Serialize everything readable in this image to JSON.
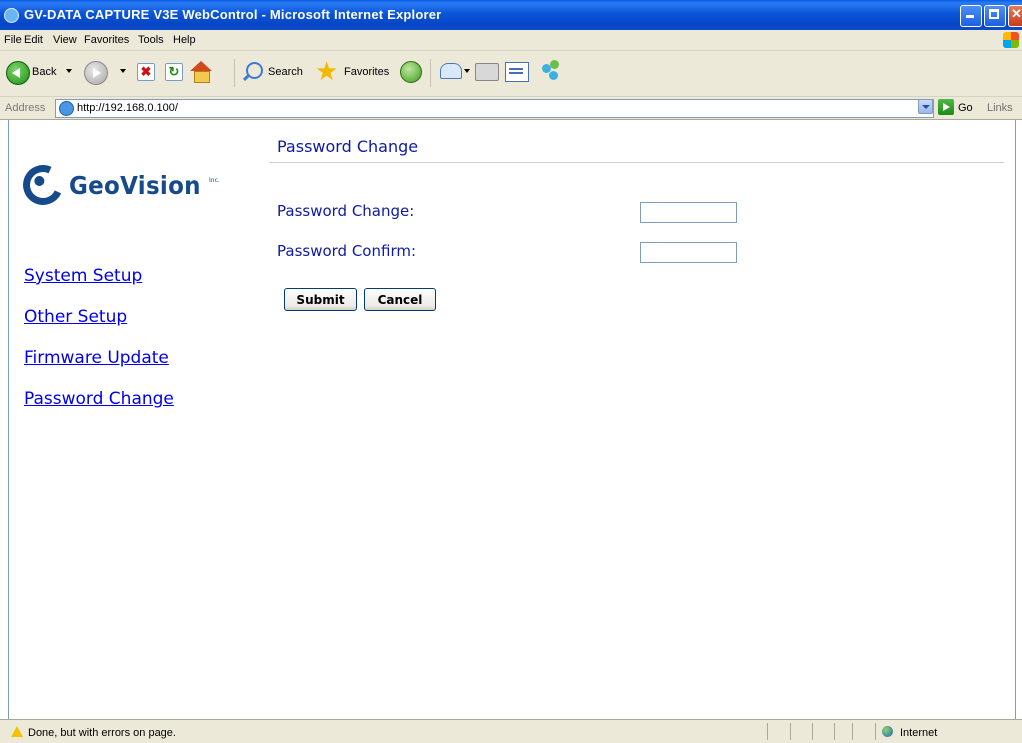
{
  "window": {
    "title": "GV-DATA CAPTURE V3E WebControl - Microsoft Internet Explorer"
  },
  "menu": [
    "File",
    "Edit",
    "View",
    "Favorites",
    "Tools",
    "Help"
  ],
  "toolbar": {
    "back_label": "Back",
    "search_label": "Search",
    "favorites_label": "Favorites"
  },
  "address": {
    "label": "Address",
    "url": "http://192.168.0.100/",
    "go_label": "Go",
    "links_label": "Links"
  },
  "logo": {
    "text": "GeoVision",
    "suffix": "Inc."
  },
  "sidebar": {
    "items": [
      {
        "label": "System Setup"
      },
      {
        "label": "Other Setup"
      },
      {
        "label": "Firmware Update"
      },
      {
        "label": "Password Change"
      }
    ]
  },
  "main": {
    "title": "Password Change",
    "fields": [
      {
        "label": "Password Change:",
        "value": ""
      },
      {
        "label": "Password Confirm:",
        "value": ""
      }
    ],
    "submit_label": "Submit",
    "cancel_label": "Cancel"
  },
  "status": {
    "text": "Done, but with errors on page.",
    "zone": "Internet"
  },
  "colors": {
    "title_bar": "#0b55d8",
    "link": "#0000ee",
    "heading": "#0e1aa6",
    "logo": "#164a8b"
  }
}
